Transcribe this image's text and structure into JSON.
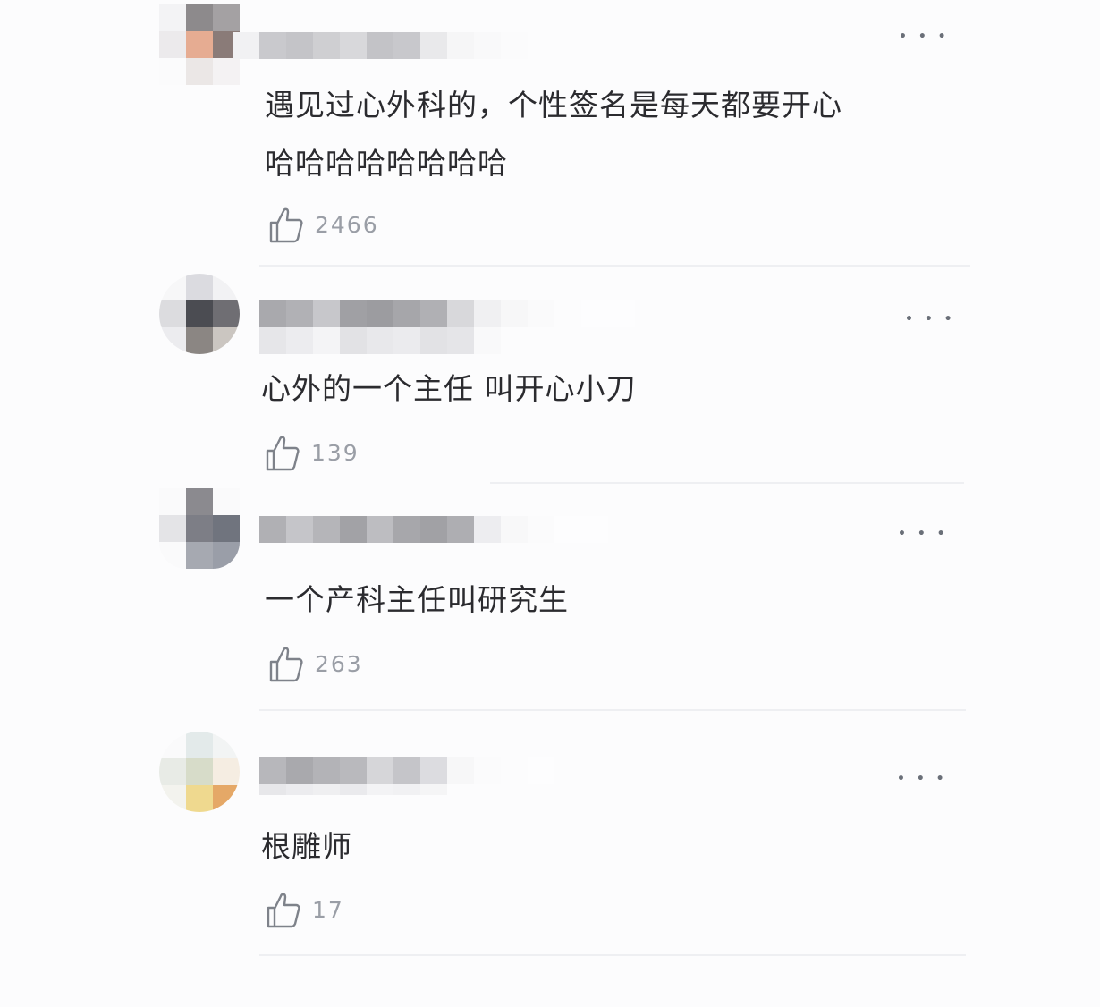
{
  "comments": [
    {
      "text_lines": [
        "遇见过心外科的，个性签名是每天都要开心",
        "哈哈哈哈哈哈哈哈"
      ],
      "likes": "2466",
      "more_icon": "ellipsis-icon",
      "like_icon": "thumbs-up-icon"
    },
    {
      "text_lines": [
        "心外的一个主任 叫开心小刀"
      ],
      "likes": "139",
      "more_icon": "ellipsis-icon",
      "like_icon": "thumbs-up-icon"
    },
    {
      "text_lines": [
        "一个产科主任叫研究生"
      ],
      "likes": "263",
      "more_icon": "ellipsis-icon",
      "like_icon": "thumbs-up-icon"
    },
    {
      "text_lines": [
        "根雕师"
      ],
      "likes": "17",
      "more_icon": "ellipsis-icon",
      "like_icon": "thumbs-up-icon"
    }
  ],
  "more_glyph": "• • •"
}
